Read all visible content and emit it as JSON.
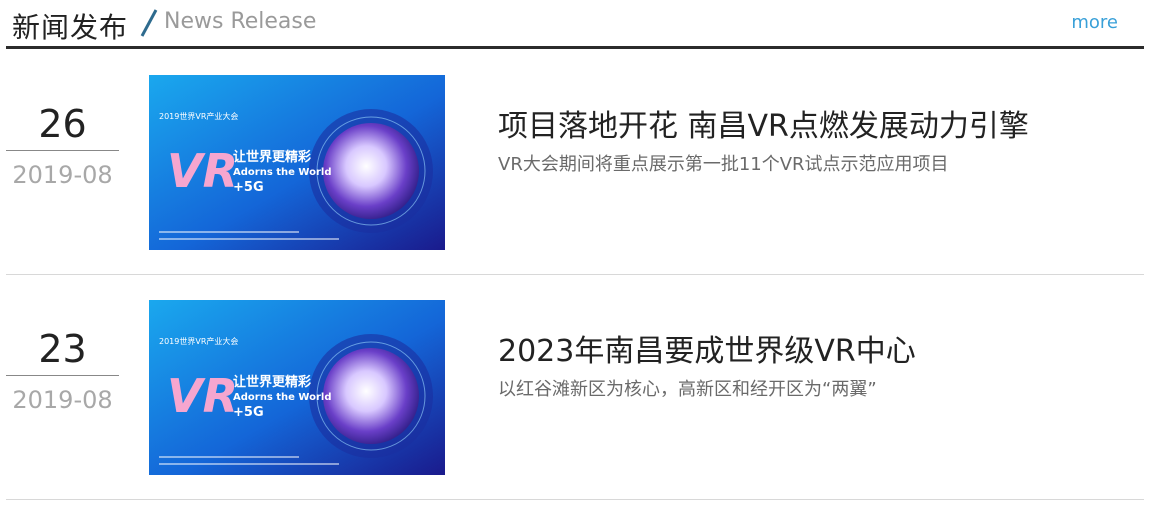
{
  "header": {
    "title_cn": "新闻发布",
    "title_en": "News Release",
    "more_label": "more",
    "accent_color": "#2e6b8e",
    "more_color": "#39a0d8"
  },
  "news": [
    {
      "day": "26",
      "year_month": "2019-08",
      "headline": "项目落地开花 南昌VR点燃发展动力引擎",
      "summary": "VR大会期间将重点展示第一批11个VR试点示范应用项目",
      "image": {
        "top_badge": "2019世界VR产业大会",
        "big_text": "VR",
        "slogan_cn": "让世界更精彩",
        "slogan_en": "Adorns the World",
        "tag": "+5G"
      }
    },
    {
      "day": "23",
      "year_month": "2019-08",
      "headline": "2023年南昌要成世界级VR中心",
      "summary": "以红谷滩新区为核心，高新区和经开区为“两翼”",
      "image": {
        "top_badge": "2019世界VR产业大会",
        "big_text": "VR",
        "slogan_cn": "让世界更精彩",
        "slogan_en": "Adorns the World",
        "tag": "+5G"
      }
    }
  ]
}
